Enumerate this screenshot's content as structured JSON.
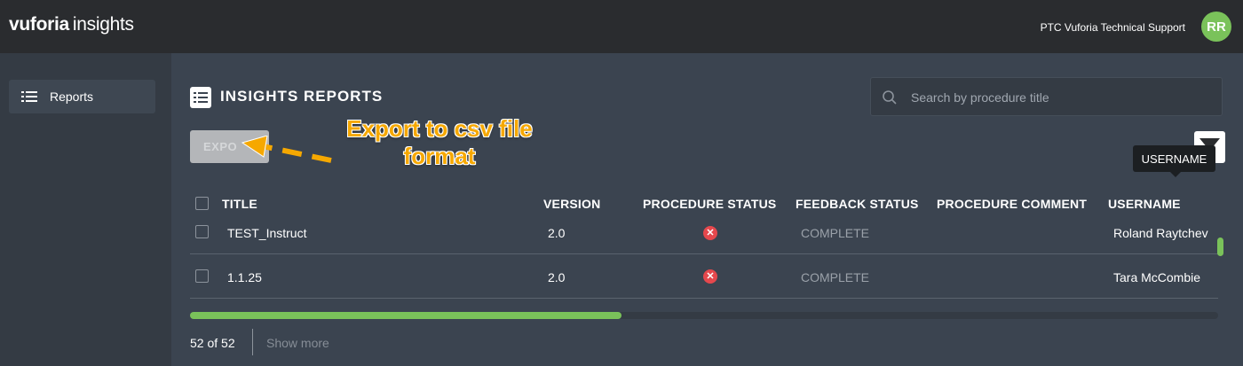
{
  "header": {
    "brand_primary": "vuforia",
    "brand_secondary": "insights",
    "org_name": "PTC Vuforia Technical Support",
    "avatar_initials": "RR",
    "accent_color": "#7ac25a"
  },
  "sidebar": {
    "items": [
      {
        "label": "Reports",
        "icon": "list-icon"
      }
    ]
  },
  "main": {
    "title": "INSIGHTS REPORTS",
    "search_placeholder": "Search by procedure title",
    "export_label": "EXPORT",
    "export_visible_label": "EXPO",
    "annotation_line1": "Export to csv file",
    "annotation_line2": "format",
    "annotation_color": "#f6a800",
    "tooltip": "USERNAME",
    "columns": [
      "TITLE",
      "VERSION",
      "PROCEDURE STATUS",
      "FEEDBACK STATUS",
      "PROCEDURE COMMENT",
      "USERNAME"
    ],
    "rows": [
      {
        "title": "TEST_Instruct",
        "version": "2.0",
        "procedure_status": "error",
        "feedback_status": "COMPLETE",
        "procedure_comment": "",
        "username": "Roland Raytchev"
      },
      {
        "title": "1.1.25",
        "version": "2.0",
        "procedure_status": "error",
        "feedback_status": "COMPLETE",
        "procedure_comment": "",
        "username": "Tara McCombie"
      }
    ],
    "count": "52 of 52",
    "show_more": "Show more",
    "horizontal_scroll_fraction": 0.42
  }
}
